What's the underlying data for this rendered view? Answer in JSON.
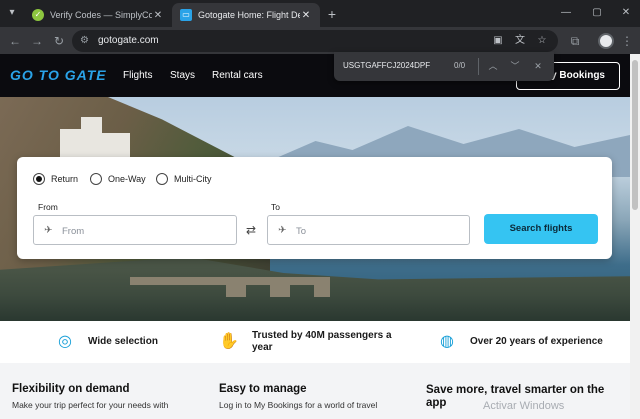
{
  "browser": {
    "tabs": [
      {
        "title": "Verify Codes — SimplyCodes",
        "active": false,
        "favicon": "simplycodes-check-icon",
        "color": "#8dc63f"
      },
      {
        "title": "Gotogate Home: Flight Deals to",
        "active": true,
        "favicon": "gotogate-icon",
        "color": "#2aa3e8"
      }
    ],
    "new_tab": "+",
    "url": "gotogate.com"
  },
  "findbar": {
    "query": "USGTGAFFCJ2024DPF",
    "count": "0/0"
  },
  "site": {
    "logo": "GO TO GATE",
    "nav": [
      "Flights",
      "Stays",
      "Rental cars"
    ],
    "my_bookings": "My Bookings"
  },
  "search": {
    "trip_types": [
      "Return",
      "One-Way",
      "Multi-City"
    ],
    "selected_trip": "Return",
    "from_label": "From",
    "from_placeholder": "From",
    "to_label": "To",
    "to_placeholder": "To",
    "button": "Search flights"
  },
  "features": [
    {
      "icon": "coins-icon",
      "text": "Wide selection"
    },
    {
      "icon": "handshake-icon",
      "text": "Trusted by 40M passengers a year"
    },
    {
      "icon": "globe-icon",
      "text": "Over 20 years of experience"
    }
  ],
  "info": [
    {
      "title": "Flexibility on demand",
      "body": "Make your trip perfect for your needs with"
    },
    {
      "title": "Easy to manage",
      "body": "Log in to My Bookings for a world of travel"
    },
    {
      "title": "Save more, travel smarter on the app",
      "body": ""
    }
  ],
  "watermark": "Activar Windows",
  "colors": {
    "accent": "#35c4f2",
    "brand": "#2aa3e8",
    "header_bg": "#0b0b0f"
  }
}
